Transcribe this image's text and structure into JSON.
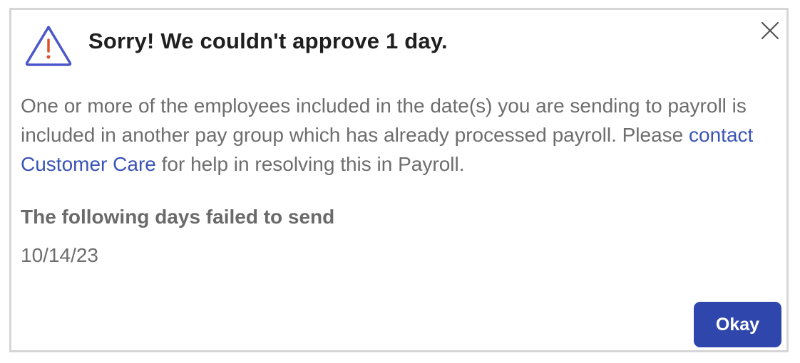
{
  "dialog": {
    "title": "Sorry! We couldn't approve 1 day.",
    "icons": {
      "warning": "warning-triangle-icon",
      "close": "close-icon"
    },
    "message": {
      "text_before": "One or more of the employees included in the date(s) you are sending to payroll is included in another pay group which has already processed payroll. Please ",
      "link_text": "contact Customer Care",
      "text_after": " for help in resolving this in Payroll."
    },
    "failed_section": {
      "label": "The following days failed to send",
      "dates": [
        "10/14/23"
      ]
    },
    "okay_label": "Okay"
  },
  "colors": {
    "warning_outline": "#4b57c8",
    "warning_mark": "#e0502a",
    "link": "#3a54b4",
    "primary_button": "#2f47ac",
    "title_text": "#1f1f1f",
    "body_text": "#6d6d6d"
  }
}
